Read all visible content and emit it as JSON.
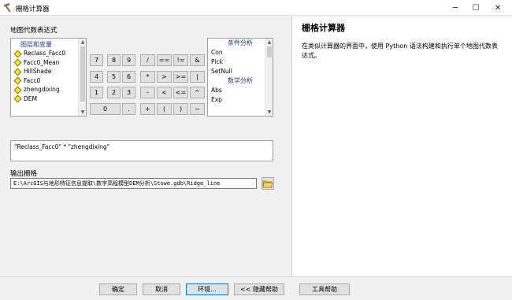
{
  "window": {
    "title": "栅格计算器",
    "controls": {
      "minimize": "─",
      "maximize": "☐",
      "close": "✕"
    }
  },
  "map_algebra": {
    "label": "地图代数表达式",
    "layers": {
      "header": "图层和变量",
      "items": [
        "Reclass_Facc0",
        "Facc0_Mean",
        "HillShade",
        "Facc0",
        "zhengdixing",
        "DEM"
      ]
    },
    "keypad": {
      "row1": [
        "7",
        "8",
        "9",
        "/",
        "==",
        "!=",
        "&"
      ],
      "row2": [
        "4",
        "5",
        "6",
        "*",
        ">",
        ">=",
        "|"
      ],
      "row3": [
        "1",
        "2",
        "3",
        "-",
        "<",
        "<=",
        "^"
      ],
      "row4": [
        "0",
        ".",
        "+",
        "(",
        ")",
        "~"
      ]
    },
    "functions": {
      "cond_header": "条件分析",
      "cond_items": [
        "Con",
        "Pick",
        "SetNull"
      ],
      "math_header": "数学分析",
      "math_items": [
        "Abs",
        "Exp"
      ]
    },
    "expression": "\"Reclass_Facc0\" * \"zhengdixing\""
  },
  "output": {
    "label": "输出栅格",
    "value": "E:\\ArcGIS与地形特征信息提取\\数字高程模型DEM分析\\Stowe.gdb\\Ridge_line"
  },
  "help": {
    "title": "栅格计算器",
    "text": "在类似计算器的界面中，使用 Python 语法构建和执行单个地图代数表达式。"
  },
  "buttons": {
    "ok": "确定",
    "cancel": "取消",
    "env": "环境...",
    "hide_help": "<< 隐藏帮助",
    "tool_help": "工具帮助"
  }
}
